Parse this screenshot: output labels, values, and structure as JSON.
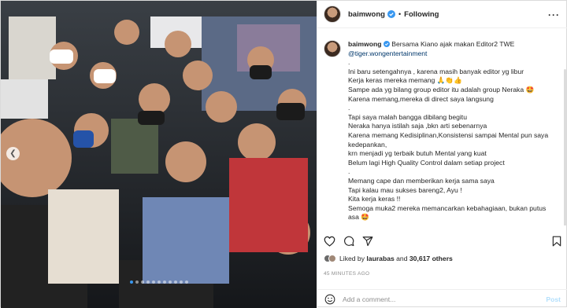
{
  "post": {
    "username": "baimwong",
    "follow_label": "Following",
    "separator": "•",
    "more_icon": "more-horizontal-icon",
    "verified_icon": "verified-badge-icon"
  },
  "caption": {
    "username": "baimwong",
    "lines": [
      "Bersama Kiano ajak makan Editor2 TWE",
      "@tiger.wongentertainment",
      ".",
      "Ini baru setengahnya , karena masih banyak editor yg libur",
      "Kerja keras mereka memang 🙏👏👍",
      "Sampe ada yg bilang group editor itu adalah group Neraka 🤩",
      "Karena memang,mereka di direct saya langsung",
      ".",
      "Tapi saya malah bangga dibilang begitu",
      "Neraka hanya istilah saja ,bkn arti sebenarnya",
      "Karena memang Kedisiplinan,Konsistensi sampai Mental pun saya kedepankan,",
      "krn menjadi yg terbaik butuh Mental yang kuat",
      "Belum lagi High Quality Control dalam setiap project",
      ".",
      "Memang cape dan memberikan kerja sama saya",
      "Tapi kalau mau sukses bareng2, Ayu !",
      "Kita kerja keras !!",
      "Semoga muka2 mereka memancarkan kebahagiaan, bukan putus asa 🤩"
    ]
  },
  "actions": {
    "like_icon": "heart-icon",
    "comment_icon": "comment-icon",
    "share_icon": "share-icon",
    "save_icon": "bookmark-icon"
  },
  "likes": {
    "prefix": "Liked by",
    "user": "laurabas",
    "and": "and",
    "others": "30,617 others"
  },
  "timestamp": "45 MINUTES AGO",
  "comment": {
    "placeholder": "Add a comment...",
    "post_label": "Post",
    "emoji_icon": "smiley-icon"
  },
  "carousel": {
    "total": 11,
    "active_index": 0,
    "prev_icon": "chevron-left-icon"
  }
}
